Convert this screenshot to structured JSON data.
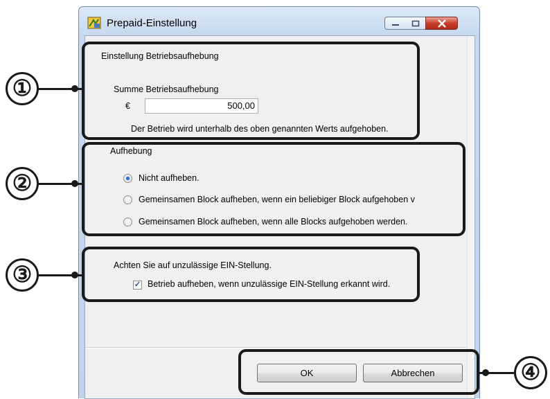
{
  "window": {
    "title": "Prepaid-Einstellung",
    "icon": "settings-app-icon",
    "controls": [
      "minimize-icon",
      "maximize-icon",
      "close-icon"
    ]
  },
  "section1": {
    "heading": "Einstellung Betriebsaufhebung",
    "sum_label": "Summe Betriebsaufhebung",
    "currency": "€",
    "sum_value": "500,00",
    "note": "Der Betrieb wird unterhalb des oben genannten Werts aufgehoben."
  },
  "section2": {
    "heading": "Aufhebung",
    "options": [
      {
        "label": "Nicht aufheben.",
        "selected": true
      },
      {
        "label": "Gemeinsamen Block aufheben, wenn ein beliebiger Block aufgehoben v",
        "selected": false
      },
      {
        "label": "Gemeinsamen Block aufheben, wenn alle Blocks aufgehoben werden.",
        "selected": false
      }
    ]
  },
  "section3": {
    "heading": "Achten Sie auf unzulässige EIN-Stellung.",
    "checkbox_label": "Betrieb aufheben, wenn unzulässige EIN-Stellung erkannt wird.",
    "checked": true
  },
  "buttons": {
    "ok": "OK",
    "cancel": "Abbrechen"
  },
  "callouts": {
    "c1": "①",
    "c2": "②",
    "c3": "③",
    "c4": "④"
  },
  "colors": {
    "callout": "#1a1a1a",
    "close_button": "#c8402d",
    "radio_selected": "#2a6fd2"
  }
}
